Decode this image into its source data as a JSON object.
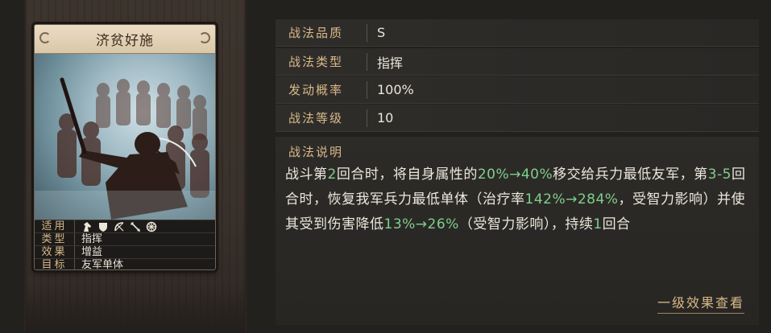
{
  "card": {
    "title": "济贫好施",
    "attrs": {
      "applies_label": "适用",
      "applies_icons": [
        "cavalry-horse-icon",
        "shield-infantry-icon",
        "bow-archer-icon",
        "spear-icon",
        "chariot-wheel-icon"
      ],
      "type_label": "类型",
      "type_value": "指挥",
      "effect_label": "效果",
      "effect_value": "增益",
      "target_label": "目标",
      "target_value": "友军单体"
    }
  },
  "info": {
    "quality_label": "战法品质",
    "quality_value": "S",
    "type_label": "战法类型",
    "type_value": "指挥",
    "rate_label": "发动概率",
    "rate_value": "100%",
    "level_label": "战法等级",
    "level_value": "10"
  },
  "description": {
    "title": "战法说明",
    "segments": {
      "s1": "战斗第",
      "h1": "2",
      "s2": "回合时，将自身属性的",
      "h2": "20%→40%",
      "s3": "移交给兵力最低友军，第",
      "h3": "3-5",
      "s4": "回合时，恢复我军兵力最低单体（治疗率",
      "h4": "142%→284%",
      "s5": "，受智力影响）并使其受到伤害降低",
      "h5": "13%→26%",
      "s6": "（受智力影响），持续",
      "h6": "1",
      "s7": "回合"
    },
    "highlight_color": "#7fcf8c"
  },
  "detail_link": "一级效果查看"
}
